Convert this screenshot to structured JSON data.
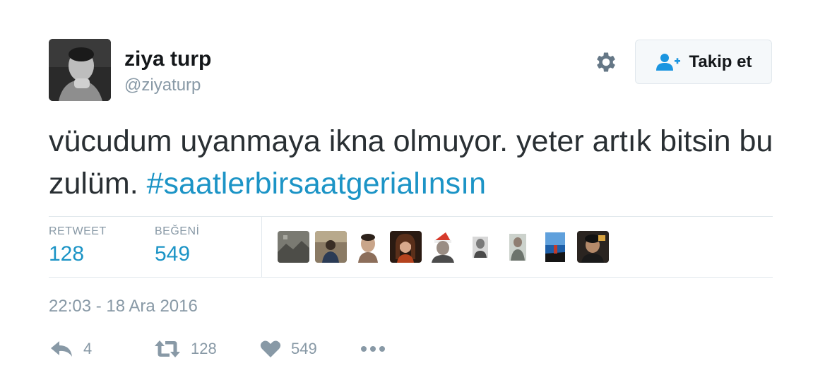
{
  "author": {
    "display_name": "ziya turp",
    "handle": "@ziyaturp"
  },
  "follow_button": {
    "label": "Takip et"
  },
  "tweet": {
    "text": "vücudum uyanmaya ikna olmuyor. yeter artık bitsin bu zulüm. ",
    "hashtag": "#saatlerbirsaatgerialınsın"
  },
  "stats": {
    "retweets_label": "RETWEET",
    "retweets_value": "128",
    "likes_label": "BEĞENİ",
    "likes_value": "549"
  },
  "timestamp": "22:03 - 18 Ara 2016",
  "actions": {
    "reply_count": "4",
    "retweet_count": "128",
    "like_count": "549"
  },
  "colors": {
    "link": "#1c94c6",
    "muted": "#8899a6",
    "text": "#292f33"
  },
  "icons": {
    "settings": "gear-icon",
    "follow": "add-user-icon",
    "reply": "reply-icon",
    "retweet": "retweet-icon",
    "like": "heart-icon",
    "more": "more-icon"
  }
}
